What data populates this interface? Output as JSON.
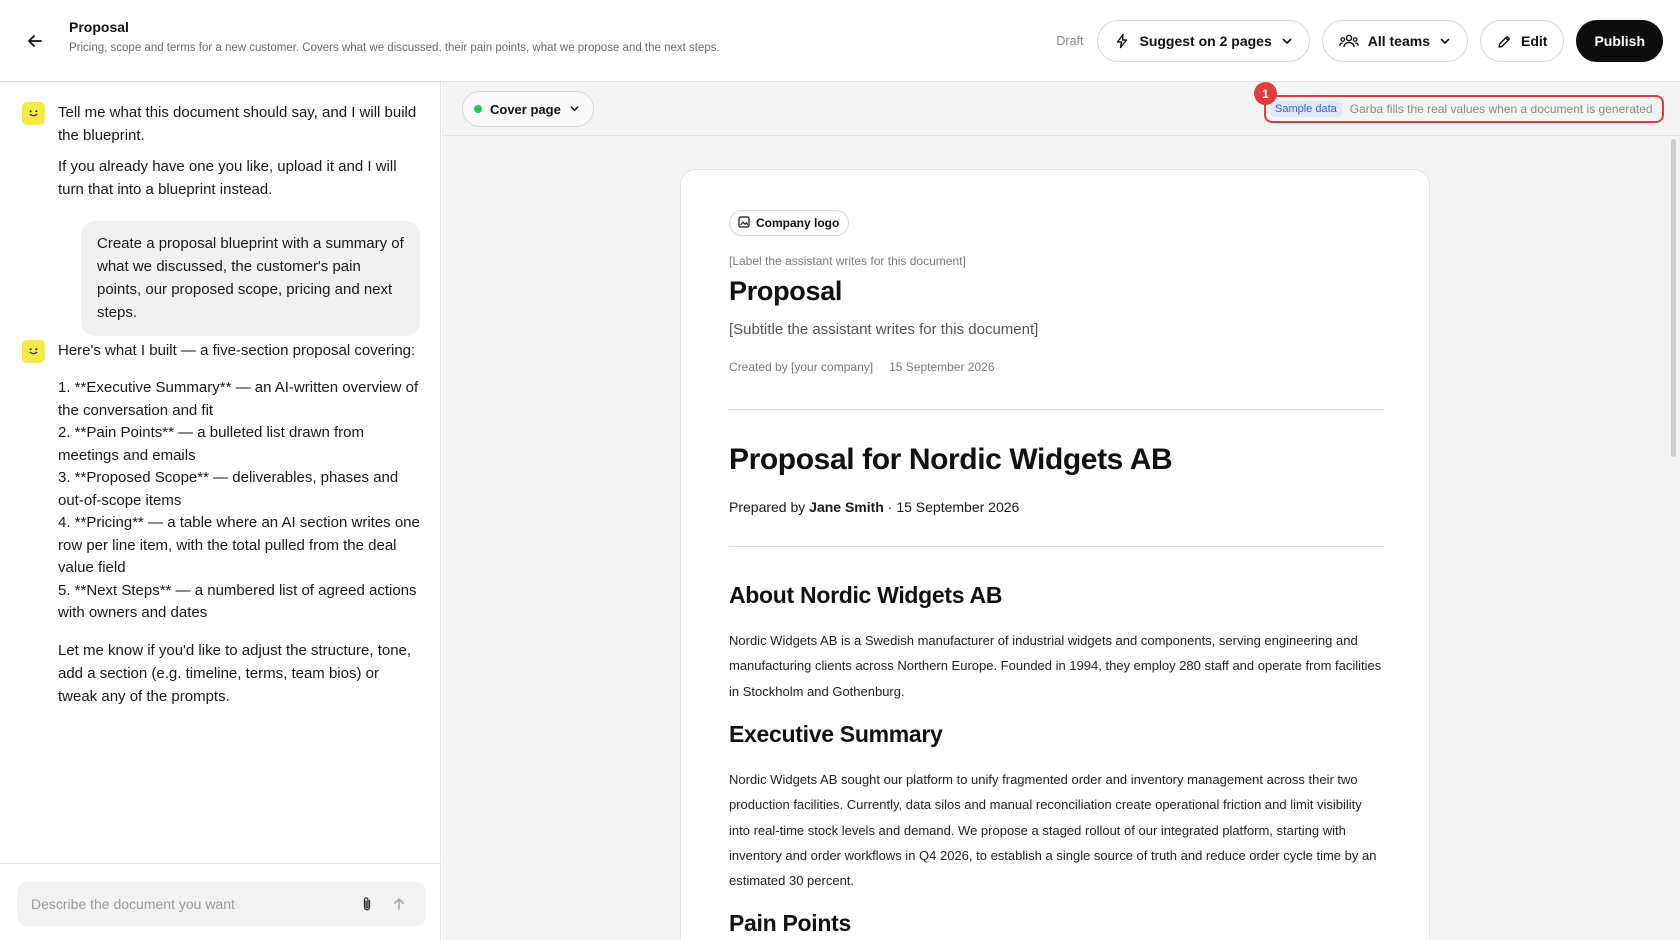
{
  "header": {
    "title": "Proposal",
    "description": "Pricing, scope and terms for a new customer. Covers what we discussed, their pain points, what we propose and the next steps.",
    "status": "Draft",
    "suggest_label": "Suggest on 2 pages",
    "teams_label": "All teams",
    "edit_label": "Edit",
    "publish_label": "Publish"
  },
  "chat": {
    "bot_intro": [
      "Tell me what this document should say, and I will build the blueprint.",
      "If you already have one you like, upload it and I will turn that into a blueprint instead."
    ],
    "user_message": "Create a proposal blueprint with a summary of what we discussed, the customer's pain points, our proposed scope, pricing and next steps.",
    "bot_reply_intro": "Here's what I built — a five-section proposal covering:",
    "bot_reply_items": [
      "1. **Executive Summary** — an AI-written overview of the conversation and fit",
      "2. **Pain Points** — a bulleted list drawn from meetings and emails",
      "3. **Proposed Scope** — deliverables, phases and out-of-scope items",
      "4. **Pricing** — a table where an AI section writes one row per line item, with the total pulled from the deal value field",
      "5. **Next Steps** — a numbered list of agreed actions with owners and dates"
    ],
    "bot_reply_closing": "Let me know if you'd like to adjust the structure, tone, add a section (e.g. timeline, terms, team bios) or tweak any of the prompts.",
    "composer_placeholder": "Describe the document you want"
  },
  "toolbar": {
    "page_select": "Cover page",
    "marker_number": "1",
    "sample_badge": "Sample data",
    "sample_note": "Garba fills the real values when a document is generated"
  },
  "document": {
    "logo_chip": "Company logo",
    "cover_label": "[Label the assistant writes for this document]",
    "cover_title": "Proposal",
    "cover_subtitle": "[Subtitle the assistant writes for this document]",
    "created_by": "Created by [your company]",
    "created_date": "15 September 2026",
    "main_title": "Proposal for Nordic Widgets AB",
    "prepared_prefix": "Prepared by",
    "prepared_name": "Jane Smith",
    "prepared_suffix": "· 15 September 2026",
    "sections": [
      {
        "heading": "About Nordic Widgets AB",
        "body": "Nordic Widgets AB is a Swedish manufacturer of industrial widgets and components, serving engineering and manufacturing clients across Northern Europe. Founded in 1994, they employ 280 staff and operate from facilities in Stockholm and Gothenburg."
      },
      {
        "heading": "Executive Summary",
        "body": "Nordic Widgets AB sought our platform to unify fragmented order and inventory management across their two production facilities. Currently, data silos and manual reconciliation create operational friction and limit visibility into real-time stock levels and demand. We propose a staged rollout of our integrated platform, starting with inventory and order workflows in Q4 2026, to establish a single source of truth and reduce order cycle time by an estimated 30 percent."
      },
      {
        "heading": "Pain Points",
        "body": ""
      }
    ]
  },
  "colors": {
    "accent_red": "#e23b3b",
    "badge_blue": "#3563c9",
    "bot_yellow": "#f5e84a",
    "status_green": "#22c55e"
  }
}
